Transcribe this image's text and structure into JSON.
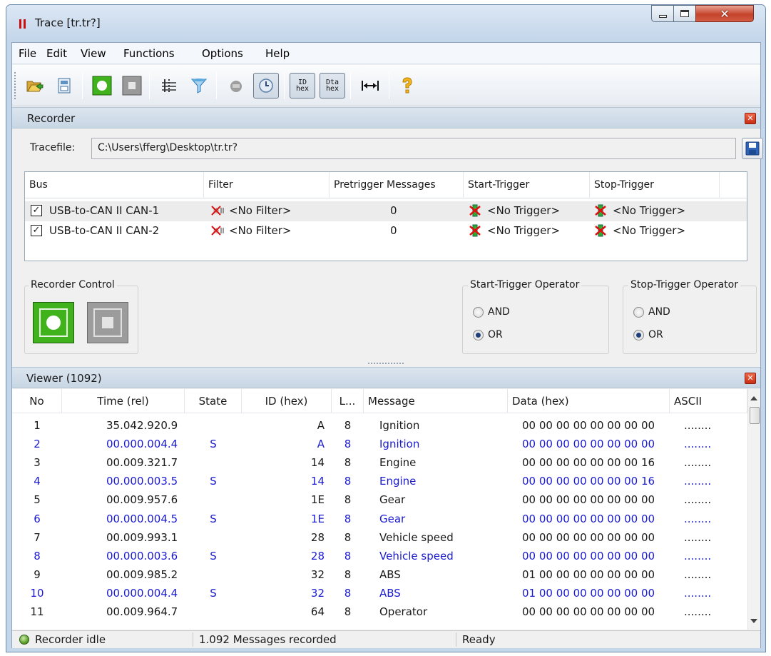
{
  "window": {
    "title": "Trace [tr.tr?]"
  },
  "menu": [
    "File",
    "Edit",
    "View",
    "Functions",
    "Options",
    "Help"
  ],
  "toolbar": {
    "id_hex": "ID hex",
    "data_hex": "Dta hex"
  },
  "recorder": {
    "title": "Recorder",
    "tracefile_label": "Tracefile:",
    "tracefile_path": "C:\\Users\\fferg\\Desktop\\tr.tr?",
    "columns": [
      "Bus",
      "Filter",
      "Pretrigger Messages",
      "Start-Trigger",
      "Stop-Trigger"
    ],
    "rows": [
      {
        "checked": true,
        "bus": "USB-to-CAN II  CAN-1",
        "filter": "<No Filter>",
        "pretrigger": "0",
        "start": "<No Trigger>",
        "stop": "<No Trigger>"
      },
      {
        "checked": true,
        "bus": "USB-to-CAN II  CAN-2",
        "filter": "<No Filter>",
        "pretrigger": "0",
        "start": "<No Trigger>",
        "stop": "<No Trigger>"
      }
    ],
    "control_title": "Recorder Control",
    "start_op_title": "Start-Trigger Operator",
    "stop_op_title": "Stop-Trigger Operator",
    "op_and": "AND",
    "op_or": "OR",
    "start_op_selected": "OR",
    "stop_op_selected": "OR"
  },
  "viewer": {
    "title": "Viewer (1092)",
    "columns": [
      "No",
      "Time (rel)",
      "State",
      "ID (hex)",
      "L...",
      "Message",
      "Data (hex)",
      "ASCII"
    ],
    "rows": [
      {
        "no": "1",
        "time": "35.042.920.9",
        "state": "",
        "id": "A",
        "len": "8",
        "msg": "Ignition",
        "data": "00 00 00 00 00 00 00 00",
        "ascii": "........",
        "blue": false
      },
      {
        "no": "2",
        "time": "00.000.004.4",
        "state": "S",
        "id": "A",
        "len": "8",
        "msg": "Ignition",
        "data": "00 00 00 00 00 00 00 00",
        "ascii": "........",
        "blue": true
      },
      {
        "no": "3",
        "time": "00.009.321.7",
        "state": "",
        "id": "14",
        "len": "8",
        "msg": "Engine",
        "data": "00 00 00 00 00 00 00 16",
        "ascii": "........",
        "blue": false
      },
      {
        "no": "4",
        "time": "00.000.003.5",
        "state": "S",
        "id": "14",
        "len": "8",
        "msg": "Engine",
        "data": "00 00 00 00 00 00 00 16",
        "ascii": "........",
        "blue": true
      },
      {
        "no": "5",
        "time": "00.009.957.6",
        "state": "",
        "id": "1E",
        "len": "8",
        "msg": "Gear",
        "data": "00 00 00 00 00 00 00 00",
        "ascii": "........",
        "blue": false
      },
      {
        "no": "6",
        "time": "00.000.004.5",
        "state": "S",
        "id": "1E",
        "len": "8",
        "msg": "Gear",
        "data": "00 00 00 00 00 00 00 00",
        "ascii": "........",
        "blue": true
      },
      {
        "no": "7",
        "time": "00.009.993.1",
        "state": "",
        "id": "28",
        "len": "8",
        "msg": "Vehicle speed",
        "data": "00 00 00 00 00 00 00 00",
        "ascii": "........",
        "blue": false
      },
      {
        "no": "8",
        "time": "00.000.003.6",
        "state": "S",
        "id": "28",
        "len": "8",
        "msg": "Vehicle speed",
        "data": "00 00 00 00 00 00 00 00",
        "ascii": "........",
        "blue": true
      },
      {
        "no": "9",
        "time": "00.009.985.2",
        "state": "",
        "id": "32",
        "len": "8",
        "msg": "ABS",
        "data": "01 00 00 00 00 00 00 00",
        "ascii": "........",
        "blue": false
      },
      {
        "no": "10",
        "time": "00.000.004.4",
        "state": "S",
        "id": "32",
        "len": "8",
        "msg": "ABS",
        "data": "01 00 00 00 00 00 00 00",
        "ascii": "........",
        "blue": true
      },
      {
        "no": "11",
        "time": "00.009.964.7",
        "state": "",
        "id": "64",
        "len": "8",
        "msg": "Operator",
        "data": "00 00 00 00 00 00 00 00",
        "ascii": "........",
        "blue": false
      }
    ],
    "send_color": "#1a1ad2"
  },
  "status": {
    "recorder_state": "Recorder idle",
    "messages": "1.092 Messages recorded",
    "ready": "Ready"
  },
  "colors": {
    "accent_green": "#3fb21c",
    "close_red": "#c92e14",
    "panel_header": "#c8d6e4"
  }
}
